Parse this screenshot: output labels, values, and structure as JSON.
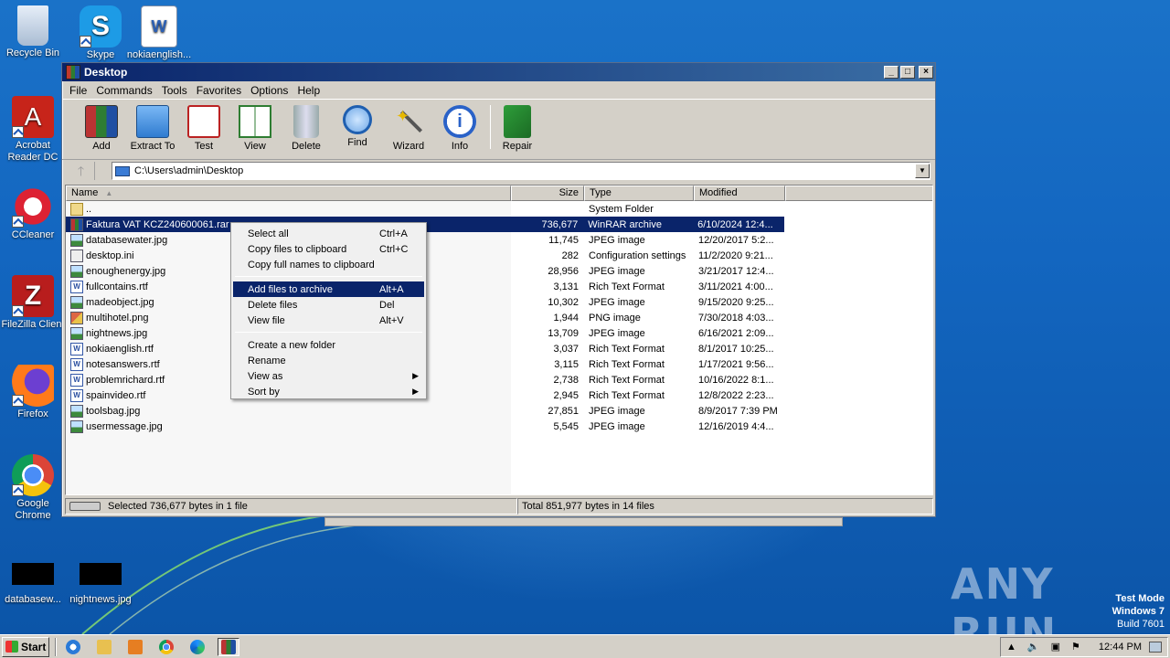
{
  "desktop": {
    "icons": [
      {
        "label": "Recycle Bin"
      },
      {
        "label": "Skype"
      },
      {
        "label": "nokiaenglish..."
      },
      {
        "label": "Acrobat Reader DC"
      },
      {
        "label": "CCleaner"
      },
      {
        "label": "FileZilla Client"
      },
      {
        "label": "Firefox"
      },
      {
        "label": "Google Chrome"
      },
      {
        "label": "databasew..."
      },
      {
        "label": "nightnews.jpg"
      }
    ],
    "watermark": "ANY RUN",
    "test_mode": {
      "line1": "Test Mode",
      "line2": "Windows 7",
      "line3": "Build 7601"
    }
  },
  "window": {
    "title": "Desktop",
    "menu": [
      "File",
      "Commands",
      "Tools",
      "Favorites",
      "Options",
      "Help"
    ],
    "toolbar": [
      "Add",
      "Extract To",
      "Test",
      "View",
      "Delete",
      "Find",
      "Wizard",
      "Info",
      "Repair"
    ],
    "address": "C:\\Users\\admin\\Desktop",
    "columns": {
      "name": "Name",
      "size": "Size",
      "type": "Type",
      "modified": "Modified"
    },
    "files": [
      {
        "name": "..",
        "size": "",
        "type": "System Folder",
        "modified": "",
        "icon": "up"
      },
      {
        "name": "Faktura VAT KCZ240600061.rar",
        "size": "736,677",
        "type": "WinRAR archive",
        "modified": "6/10/2024 12:4...",
        "icon": "rar"
      },
      {
        "name": "databasewater.jpg",
        "size": "11,745",
        "type": "JPEG image",
        "modified": "12/20/2017 5:2...",
        "icon": "jpg"
      },
      {
        "name": "desktop.ini",
        "size": "282",
        "type": "Configuration settings",
        "modified": "11/2/2020 9:21...",
        "icon": "ini"
      },
      {
        "name": "enoughenergy.jpg",
        "size": "28,956",
        "type": "JPEG image",
        "modified": "3/21/2017 12:4...",
        "icon": "jpg"
      },
      {
        "name": "fullcontains.rtf",
        "size": "3,131",
        "type": "Rich Text Format",
        "modified": "3/11/2021 4:00...",
        "icon": "rtf"
      },
      {
        "name": "madeobject.jpg",
        "size": "10,302",
        "type": "JPEG image",
        "modified": "9/15/2020 9:25...",
        "icon": "jpg"
      },
      {
        "name": "multihotel.png",
        "size": "1,944",
        "type": "PNG image",
        "modified": "7/30/2018 4:03...",
        "icon": "png"
      },
      {
        "name": "nightnews.jpg",
        "size": "13,709",
        "type": "JPEG image",
        "modified": "6/16/2021 2:09...",
        "icon": "jpg"
      },
      {
        "name": "nokiaenglish.rtf",
        "size": "3,037",
        "type": "Rich Text Format",
        "modified": "8/1/2017 10:25...",
        "icon": "rtf"
      },
      {
        "name": "notesanswers.rtf",
        "size": "3,115",
        "type": "Rich Text Format",
        "modified": "1/17/2021 9:56...",
        "icon": "rtf"
      },
      {
        "name": "problemrichard.rtf",
        "size": "2,738",
        "type": "Rich Text Format",
        "modified": "10/16/2022 8:1...",
        "icon": "rtf"
      },
      {
        "name": "spainvideo.rtf",
        "size": "2,945",
        "type": "Rich Text Format",
        "modified": "12/8/2022 2:23...",
        "icon": "rtf"
      },
      {
        "name": "toolsbag.jpg",
        "size": "27,851",
        "type": "JPEG image",
        "modified": "8/9/2017 7:39 PM",
        "icon": "jpg"
      },
      {
        "name": "usermessage.jpg",
        "size": "5,545",
        "type": "JPEG image",
        "modified": "12/16/2019 4:4...",
        "icon": "jpg"
      }
    ],
    "status_left": "Selected 736,677 bytes in 1 file",
    "status_right": "Total 851,977 bytes in 14 files"
  },
  "context_menu": {
    "items": [
      {
        "label": "Select all",
        "shortcut": "Ctrl+A"
      },
      {
        "label": "Copy files to clipboard",
        "shortcut": "Ctrl+C"
      },
      {
        "label": "Copy full names to clipboard",
        "shortcut": ""
      },
      {
        "label": "Add files to archive",
        "shortcut": "Alt+A"
      },
      {
        "label": "Delete files",
        "shortcut": "Del"
      },
      {
        "label": "View file",
        "shortcut": "Alt+V"
      },
      {
        "label": "Create a new folder",
        "shortcut": ""
      },
      {
        "label": "Rename",
        "shortcut": ""
      },
      {
        "label": "View as",
        "shortcut": ""
      },
      {
        "label": "Sort by",
        "shortcut": ""
      }
    ]
  },
  "taskbar": {
    "start": "Start",
    "clock": "12:44 PM"
  }
}
